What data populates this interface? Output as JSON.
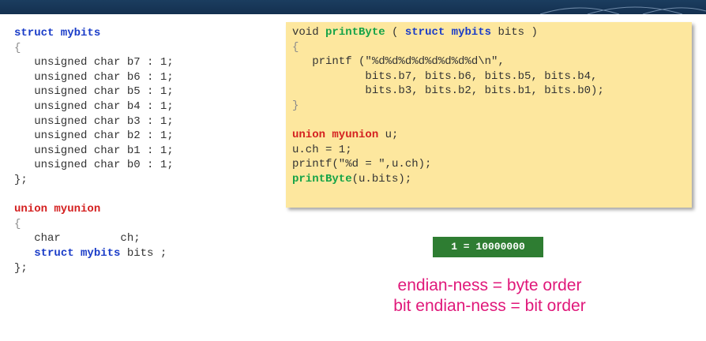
{
  "left": {
    "line1": [
      "struct mybits"
    ],
    "line2": [
      "{"
    ],
    "line3": [
      "   unsigned char b7 : 1;"
    ],
    "line4": [
      "   unsigned char b6 : 1;"
    ],
    "line5": [
      "   unsigned char b5 : 1;"
    ],
    "line6": [
      "   unsigned char b4 : 1;"
    ],
    "line7": [
      "   unsigned char b3 : 1;"
    ],
    "line8": [
      "   unsigned char b2 : 1;"
    ],
    "line9": [
      "   unsigned char b1 : 1;"
    ],
    "line10": [
      "   unsigned char b0 : 1;"
    ],
    "line11": [
      "};"
    ],
    "line12": [
      "union myunion"
    ],
    "line13": [
      "{"
    ],
    "line14": [
      "   char         ch;"
    ],
    "line15": [
      "   ",
      "struct mybits",
      " bits ;"
    ],
    "line16": [
      "};"
    ]
  },
  "right": {
    "line1": [
      "void ",
      "printByte",
      " ( ",
      "struct mybits",
      " bits )"
    ],
    "line2": [
      "{"
    ],
    "line3": [
      "   printf (\"%d%d%d%d%d%d%d%d\\n\","
    ],
    "line4": [
      "           bits.b7, bits.b6, bits.b5, bits.b4,"
    ],
    "line5": [
      "           bits.b3, bits.b2, bits.b1, bits.b0);"
    ],
    "line6": [
      "}"
    ],
    "line7": [
      "union myunion",
      " u;"
    ],
    "line8": [
      "u.ch = 1;"
    ],
    "line9": [
      "printf(\"%d = \",u.ch);"
    ],
    "line10": [
      "printByte",
      "(u.bits);"
    ]
  },
  "output": "1 = 10000000",
  "notes": [
    "endian-ness = byte order",
    "bit endian-ness = bit order"
  ],
  "colors": {
    "keyword_blue": "#1a3cc8",
    "keyword_red": "#d42020",
    "function_green": "#15a347",
    "box_background": "#fde79e",
    "output_background": "#2e7d32",
    "note_pink": "#e0187a",
    "topbar": "#143050"
  }
}
